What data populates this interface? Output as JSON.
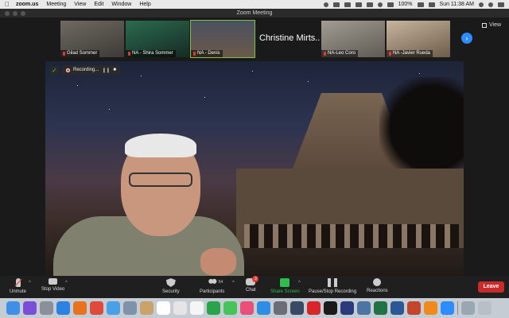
{
  "menubar": {
    "app_name": "zoom.us",
    "menus": [
      "Meeting",
      "View",
      "Edit",
      "Window",
      "Help"
    ],
    "battery": "100%",
    "clock": "Sun 11:38 AM"
  },
  "window": {
    "title": "Zoom Meeting"
  },
  "thumbnails": [
    {
      "name": "Gilad Sommer",
      "muted": true,
      "scene": "#5a5550"
    },
    {
      "name": "NA - Shira Sommer",
      "muted": true,
      "scene": "#2f5044"
    },
    {
      "name": "NA - Denis",
      "muted": true,
      "scene": "#6b6155",
      "active": true
    },
    {
      "name": "Christine Mirts...",
      "text_only": true
    },
    {
      "name": "NA-Leo Coro",
      "muted": true,
      "scene": "#8f8a80"
    },
    {
      "name": "NA -Javier Rueda",
      "muted": true,
      "scene": "#b9a690"
    }
  ],
  "view_button": "View",
  "recording": {
    "label": "Recording..."
  },
  "toolbar": {
    "unmute": "Unmute",
    "stop_video": "Stop Video",
    "security": "Security",
    "participants": "Participants",
    "participants_count": "54",
    "chat": "Chat",
    "chat_badge": "3",
    "share_screen": "Share Screen",
    "record": "Pause/Stop Recording",
    "reactions": "Reactions",
    "leave": "Leave"
  },
  "dock": {
    "apps": [
      {
        "name": "finder",
        "color": "#3f8fe8"
      },
      {
        "name": "siri",
        "color": "#7a4fd8"
      },
      {
        "name": "launchpad",
        "color": "#8a8f99"
      },
      {
        "name": "safari",
        "color": "#2b82e3"
      },
      {
        "name": "firefox",
        "color": "#e8731e"
      },
      {
        "name": "chrome",
        "color": "#e04a3b"
      },
      {
        "name": "mail",
        "color": "#4aa0e6"
      },
      {
        "name": "preview",
        "color": "#7f93a8"
      },
      {
        "name": "notes-app",
        "color": "#c9a36a"
      },
      {
        "name": "calendar",
        "color": "#ffffff"
      },
      {
        "name": "photos",
        "color": "#e5e5e5"
      },
      {
        "name": "reminders",
        "color": "#f5f5f5"
      },
      {
        "name": "numbers",
        "color": "#2aa44a"
      },
      {
        "name": "messages",
        "color": "#46c45a"
      },
      {
        "name": "itunes",
        "color": "#e8507a"
      },
      {
        "name": "app-store",
        "color": "#2f8de4"
      },
      {
        "name": "system-preferences",
        "color": "#6b6f75"
      },
      {
        "name": "quicktime",
        "color": "#3a4a66"
      },
      {
        "name": "q-app",
        "color": "#d9252a"
      },
      {
        "name": "kindle",
        "color": "#1a1a1a"
      },
      {
        "name": "photoshop",
        "color": "#2a3a7a"
      },
      {
        "name": "vk",
        "color": "#4c75a3"
      },
      {
        "name": "excel",
        "color": "#1f7244"
      },
      {
        "name": "word",
        "color": "#2b5797"
      },
      {
        "name": "powerpoint",
        "color": "#c4452b"
      },
      {
        "name": "vlc",
        "color": "#f08a1c"
      },
      {
        "name": "zoom",
        "color": "#2d8cff"
      },
      {
        "name": "finder-window",
        "color": "#9aa7b3"
      },
      {
        "name": "trash",
        "color": "#b8bfc6"
      }
    ]
  },
  "colors": {
    "accent_blue": "#2d8cff",
    "share_green": "#2fbd4b",
    "leave_red": "#c92a2a",
    "muted_red": "#e53935"
  }
}
